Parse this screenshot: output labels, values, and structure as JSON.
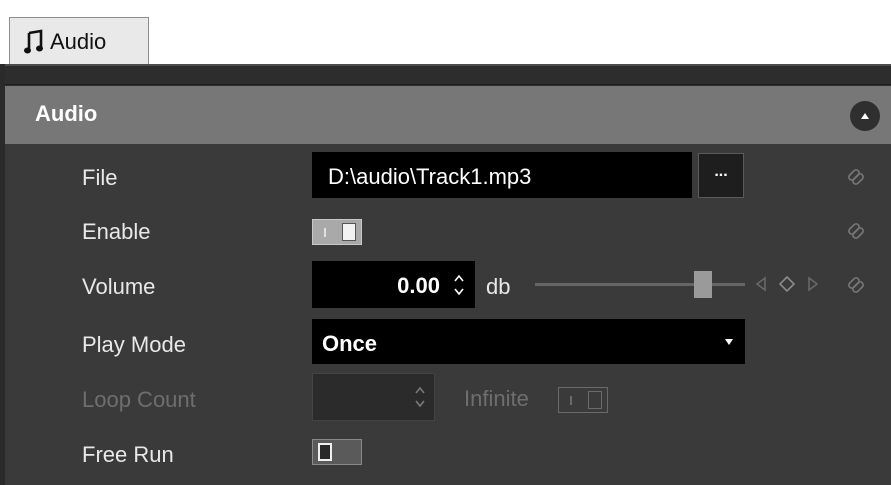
{
  "tab": {
    "label": "Audio",
    "icon": "music-note-icon"
  },
  "section": {
    "title": "Audio",
    "collapse_icon": "chevron-up-icon"
  },
  "rows": {
    "file": {
      "label": "File",
      "value": "D:\\audio\\Track1.mp3",
      "browse_label": "..."
    },
    "enable": {
      "label": "Enable",
      "state": "on"
    },
    "volume": {
      "label": "Volume",
      "value": "0.00",
      "unit": "db",
      "slider_level": 0.82
    },
    "play_mode": {
      "label": "Play Mode",
      "selected": "Once"
    },
    "loop_count": {
      "label": "Loop Count",
      "value": "",
      "infinite_label": "Infinite",
      "enabled": false
    },
    "free_run": {
      "label": "Free Run",
      "state": "off"
    }
  },
  "colors": {
    "background": "#333333",
    "header": "#777777",
    "field": "#000000",
    "text": "#e8e8e8",
    "disabled_text": "#6e6e6e"
  }
}
